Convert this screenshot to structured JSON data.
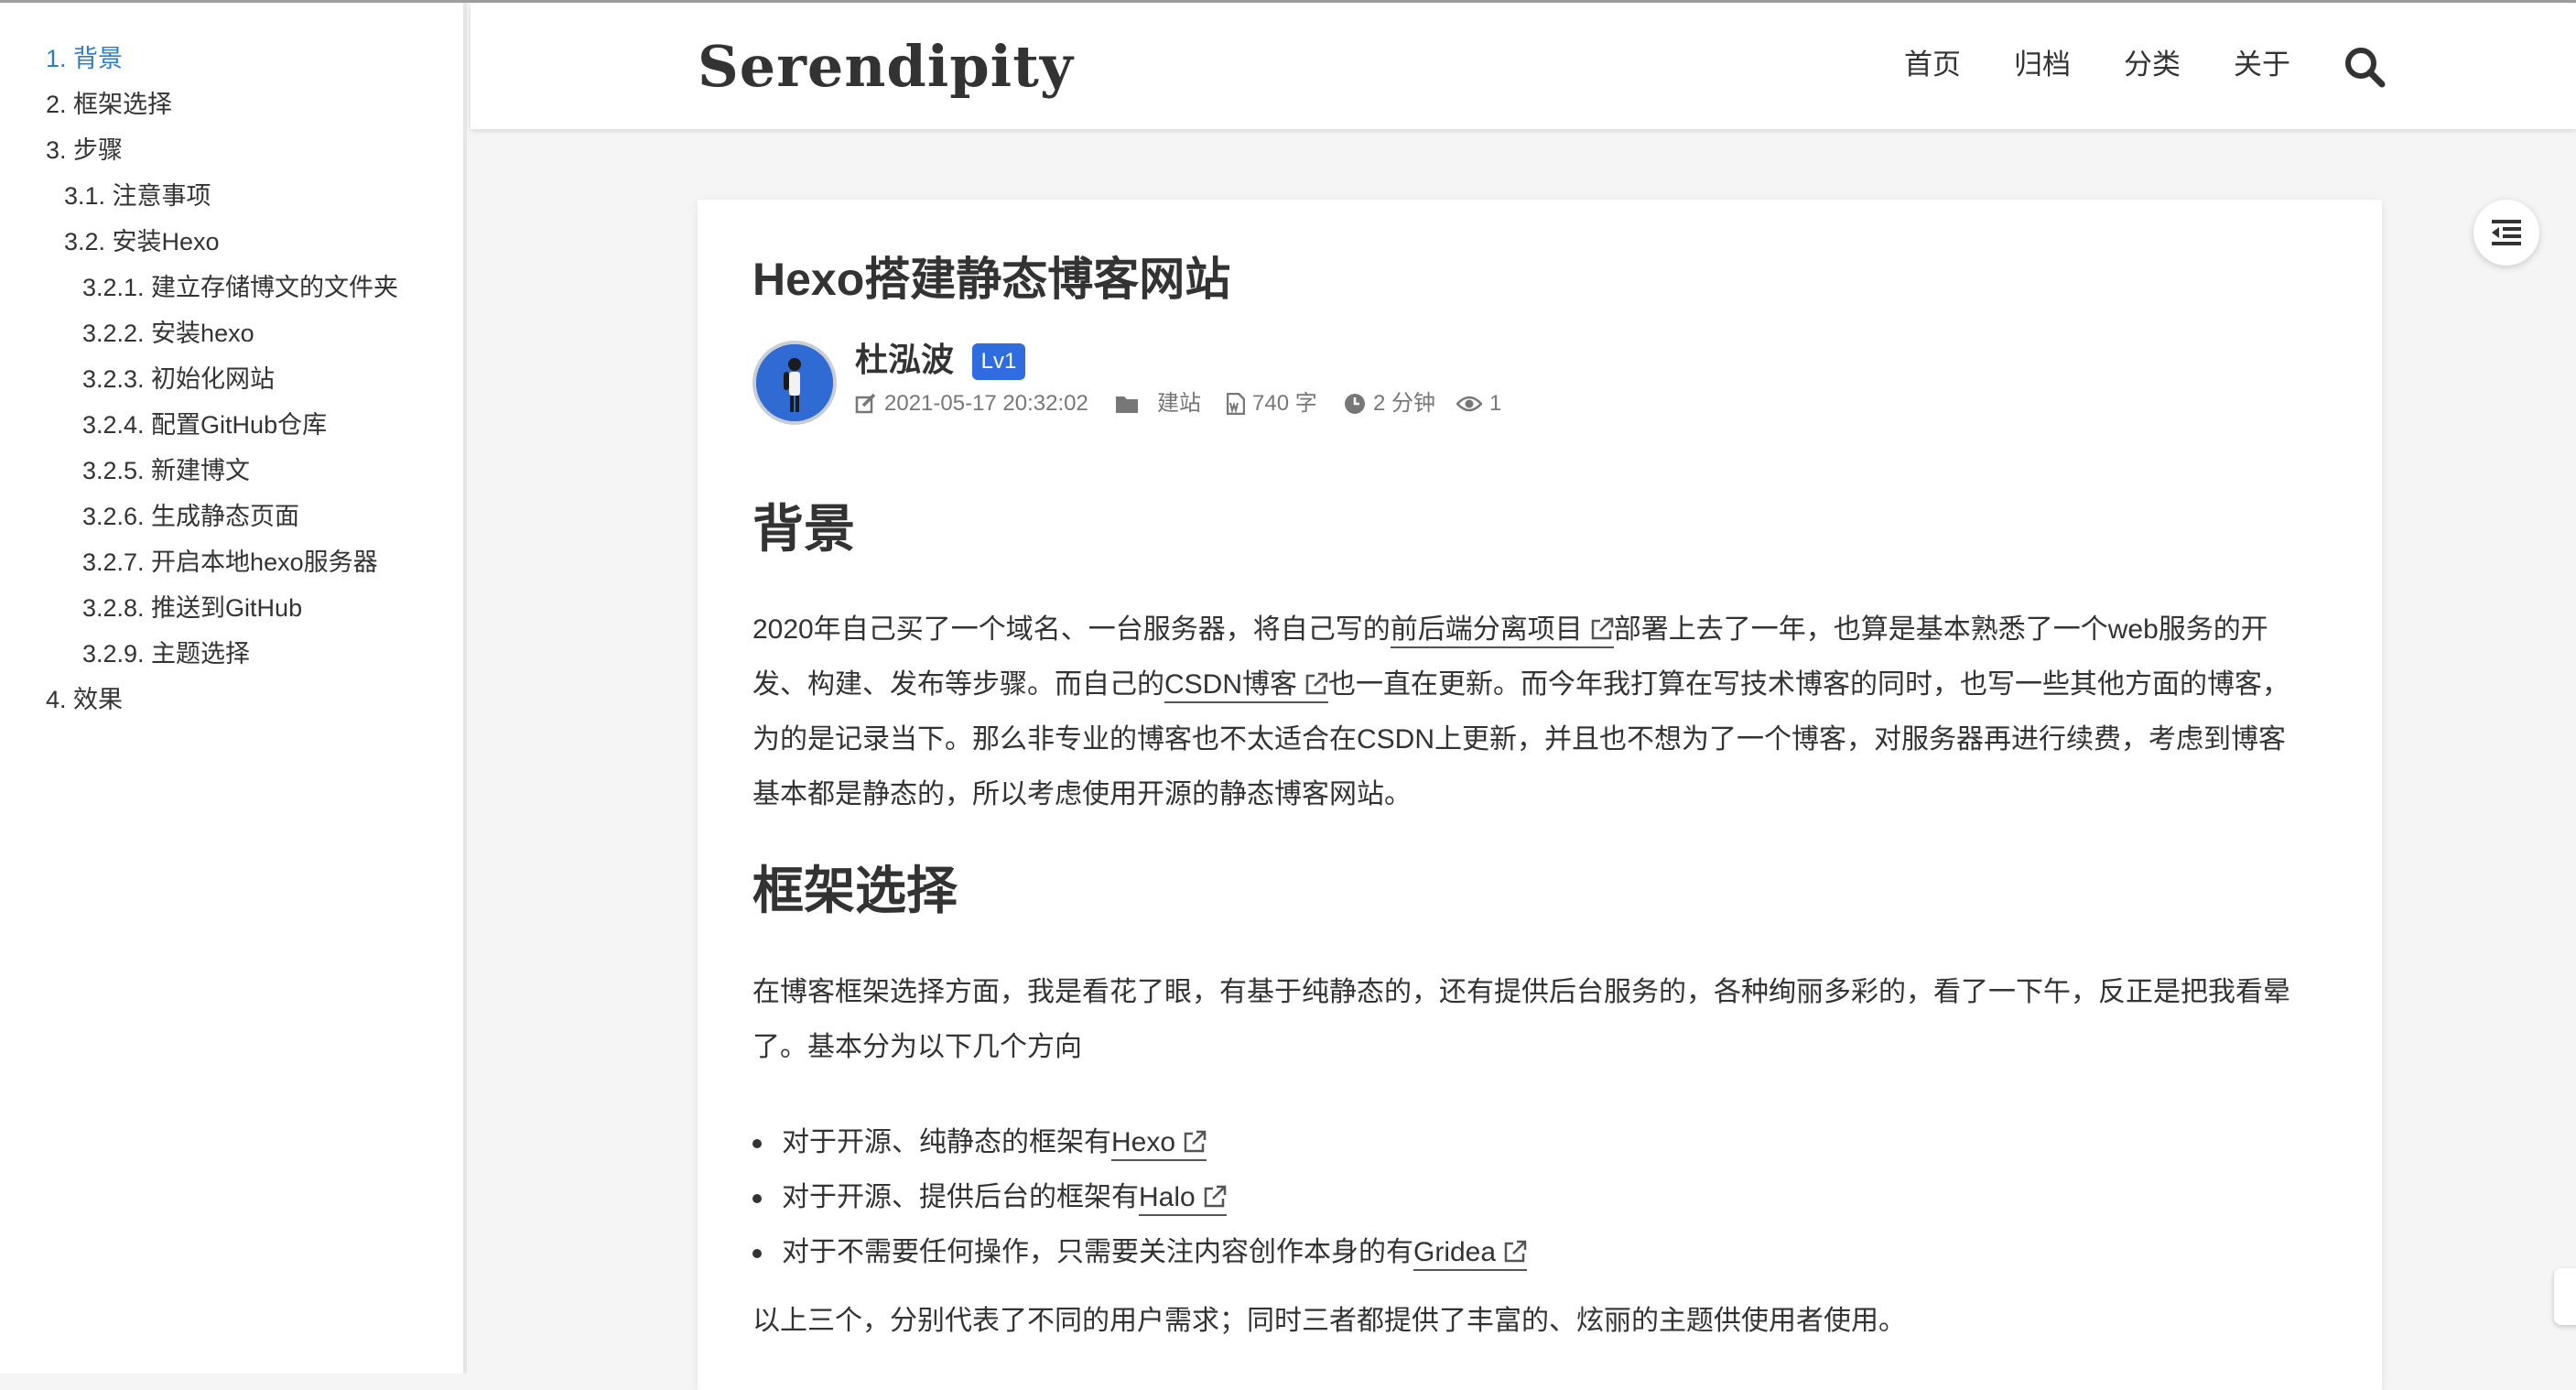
{
  "toc": {
    "items": [
      {
        "label": "1. 背景",
        "active": true
      },
      {
        "label": "2. 框架选择"
      },
      {
        "label": "3. 步骤"
      },
      {
        "label": "3.1. 注意事项"
      },
      {
        "label": "3.2. 安装Hexo"
      },
      {
        "label": "3.2.1. 建立存储博文的文件夹"
      },
      {
        "label": "3.2.2. 安装hexo"
      },
      {
        "label": "3.2.3. 初始化网站"
      },
      {
        "label": "3.2.4. 配置GitHub仓库"
      },
      {
        "label": "3.2.5. 新建博文"
      },
      {
        "label": "3.2.6. 生成静态页面"
      },
      {
        "label": "3.2.7. 开启本地hexo服务器"
      },
      {
        "label": "3.2.8. 推送到GitHub"
      },
      {
        "label": "3.2.9. 主题选择"
      },
      {
        "label": "4. 效果"
      }
    ]
  },
  "header": {
    "site_title": "Serendipity",
    "nav": [
      "首页",
      "归档",
      "分类",
      "关于"
    ],
    "search_icon": "search-icon"
  },
  "post": {
    "title": "Hexo搭建静态博客网站",
    "author": "杜泓波",
    "level": "Lv1",
    "meta": {
      "date": "2021-05-17 20:32:02",
      "category": "建站",
      "words": "740 字",
      "read_time": "2 分钟",
      "views": "1"
    },
    "sections": [
      {
        "heading": "背景",
        "p1_a": "2020年自己买了一个域名、一台服务器，将自己写的",
        "p1_link1": "前后端分离项目",
        "p1_b": "部署上去了一年，也算是基本熟悉了一个web服务的开",
        "p1_c": "发、构建、发布等步骤。而自己的",
        "p1_link2": "CSDN博客",
        "p1_d": "也一直在更新。而今年我打算在写技术博客的同时，也写一些其他方面的博客，",
        "p1_e": "为的是记录当下。那么非专业的博客也不太适合在CSDN上更新，并且也不想为了一个博客，对服务器再进行续费，考虑到博客",
        "p1_f": "基本都是静态的，所以考虑使用开源的静态博客网站。"
      },
      {
        "heading": "框架选择",
        "p2_a": "在博客框架选择方面，我是看花了眼，有基于纯静态的，还有提供后台服务的，各种绚丽多彩的，看了一下午，反正是把我看晕",
        "p2_b": "了。基本分为以下几个方向",
        "bullets": [
          {
            "text": "对于开源、纯静态的框架有",
            "link": "Hexo"
          },
          {
            "text": "对于开源、提供后台的框架有",
            "link": "Halo"
          },
          {
            "text": "对于不需要任何操作，只需要关注内容创作本身的有",
            "link": "Gridea"
          }
        ],
        "summary": "以上三个，分别代表了不同的用户需求；同时三者都提供了丰富的、炫丽的主题供使用者使用。"
      }
    ]
  },
  "colors": {
    "accent": "#2c7dc9",
    "badge": "#2f6ce0"
  }
}
